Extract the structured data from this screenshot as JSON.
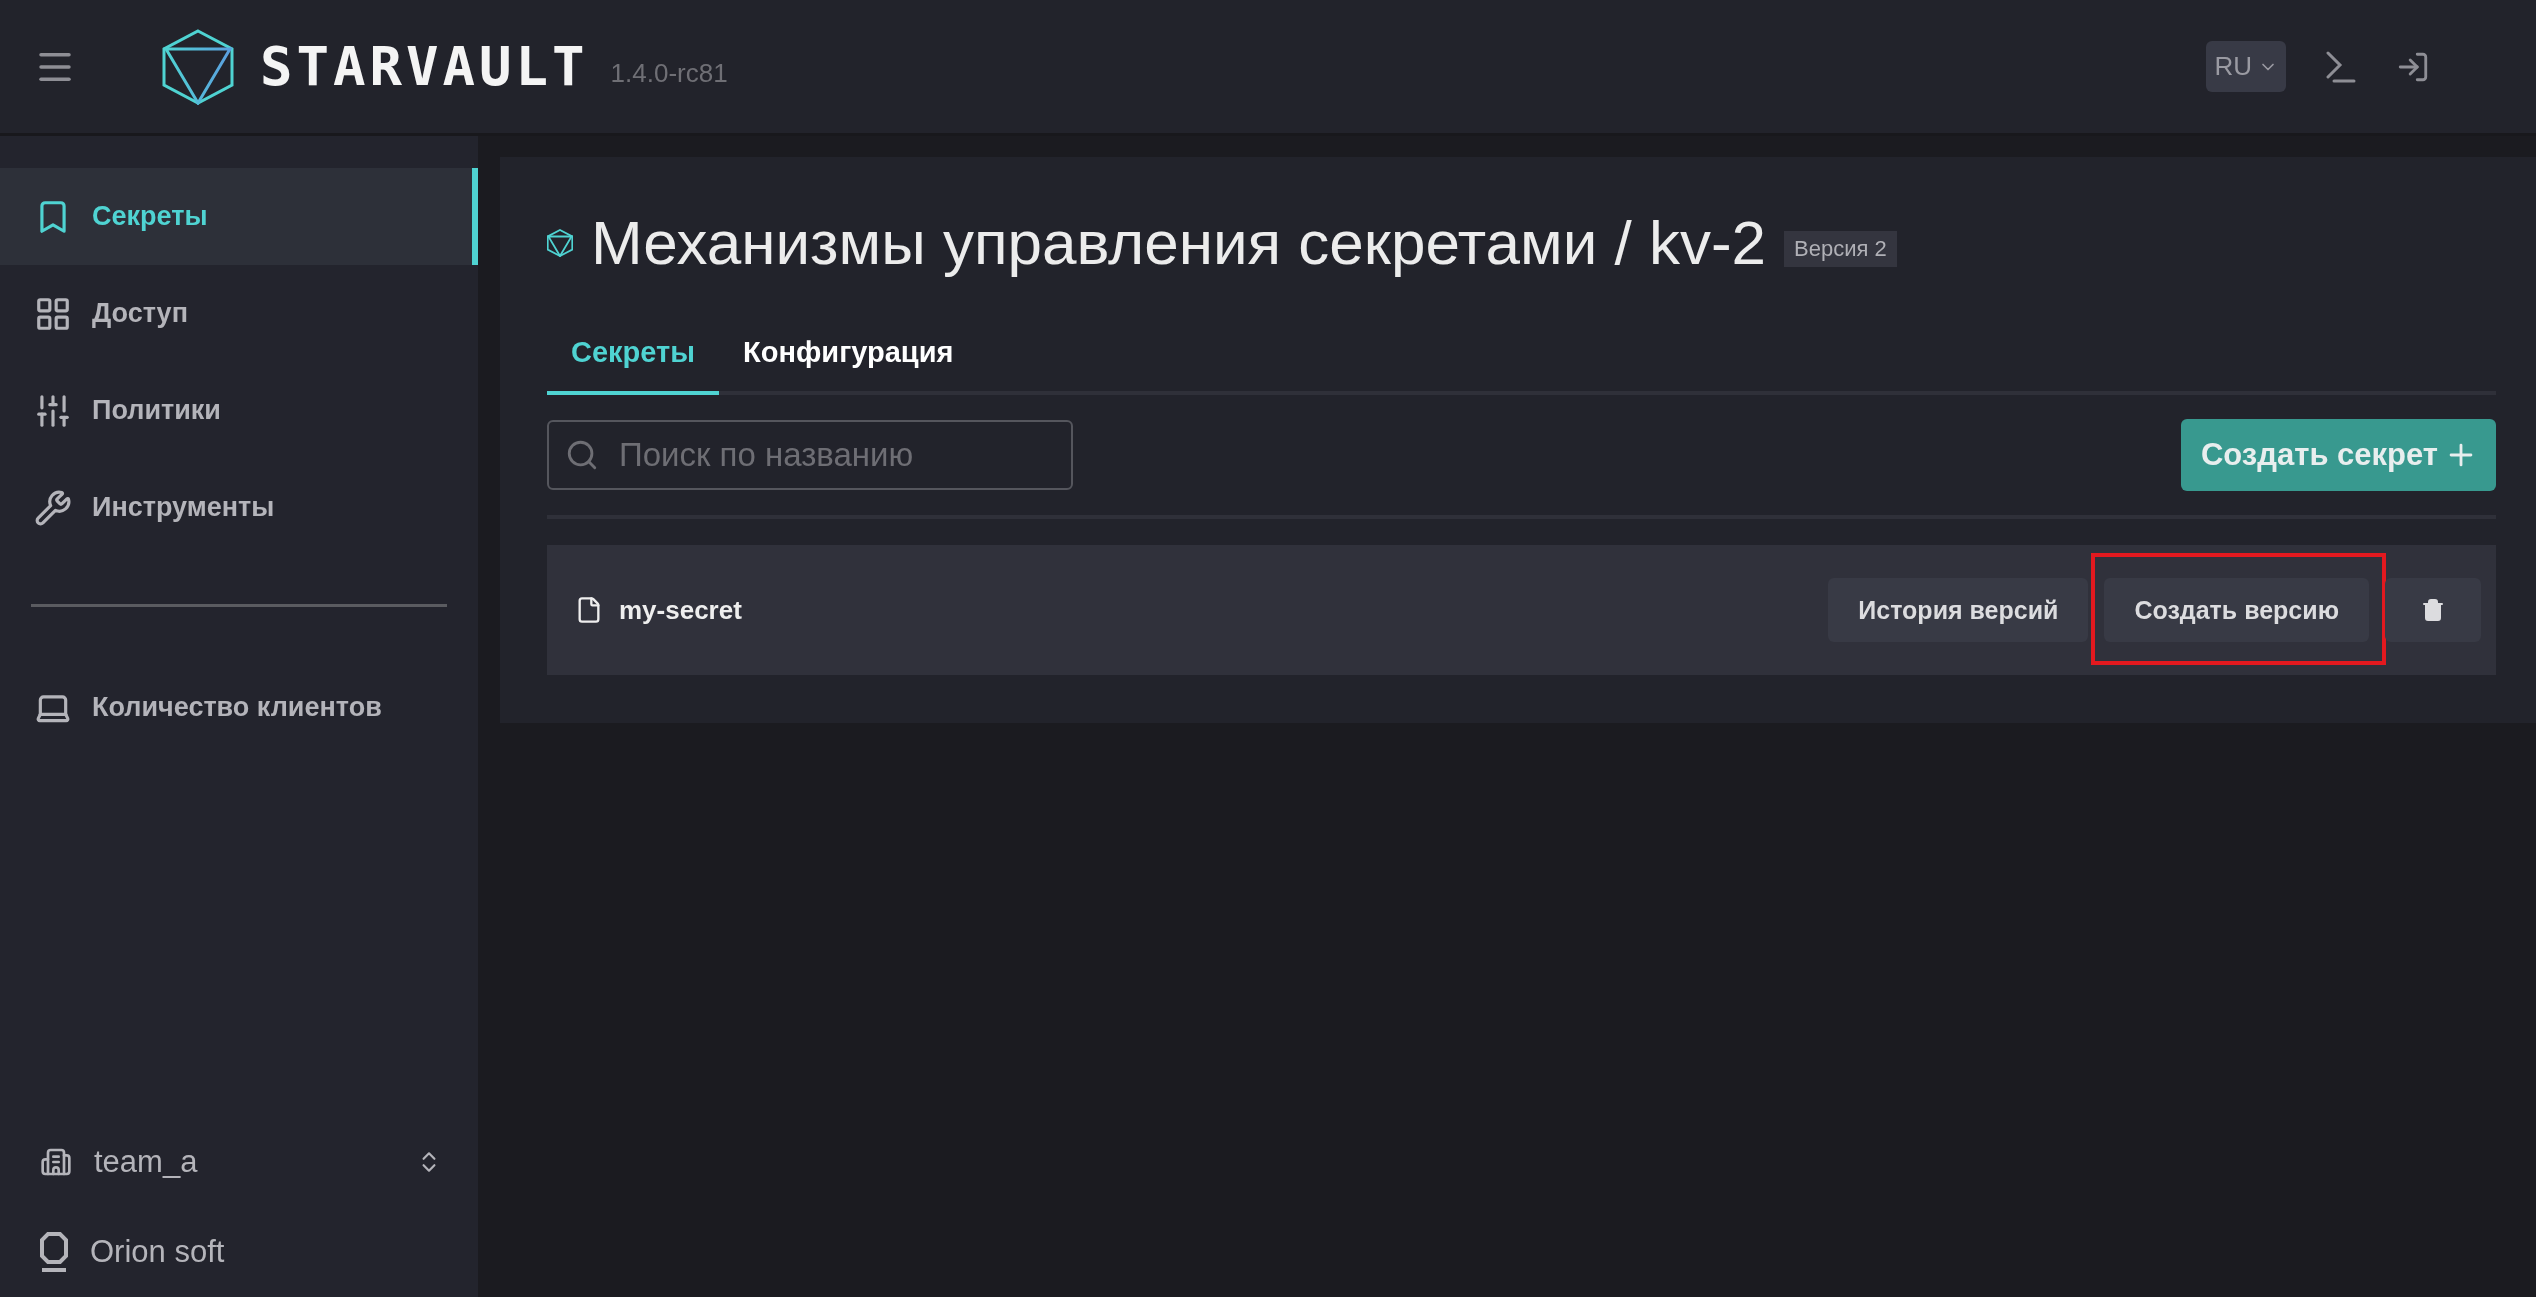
{
  "header": {
    "brand": "STARVAULT",
    "version": "1.4.0-rc81",
    "language": "RU"
  },
  "sidebar": {
    "items": [
      {
        "label": "Секреты",
        "selected": true
      },
      {
        "label": "Доступ",
        "selected": false
      },
      {
        "label": "Политики",
        "selected": false
      },
      {
        "label": "Инструменты",
        "selected": false
      }
    ],
    "extra_items": [
      {
        "label": "Количество клиентов",
        "selected": false
      }
    ],
    "namespace": "team_a",
    "organization": "Orion soft"
  },
  "page": {
    "title": "Механизмы управления секретами / kv-2",
    "badge": "Версия 2",
    "tabs": [
      {
        "label": "Секреты",
        "selected": true
      },
      {
        "label": "Конфигурация",
        "selected": false
      }
    ],
    "search": {
      "placeholder": "Поиск по названию"
    },
    "create_button": "Создать секрет",
    "secrets": [
      {
        "name": "my-secret",
        "actions": [
          {
            "kind": "text",
            "label": "История версий",
            "highlighted": false
          },
          {
            "kind": "text",
            "label": "Создать версию",
            "highlighted": true
          },
          {
            "kind": "delete",
            "highlighted": false
          }
        ]
      }
    ]
  }
}
